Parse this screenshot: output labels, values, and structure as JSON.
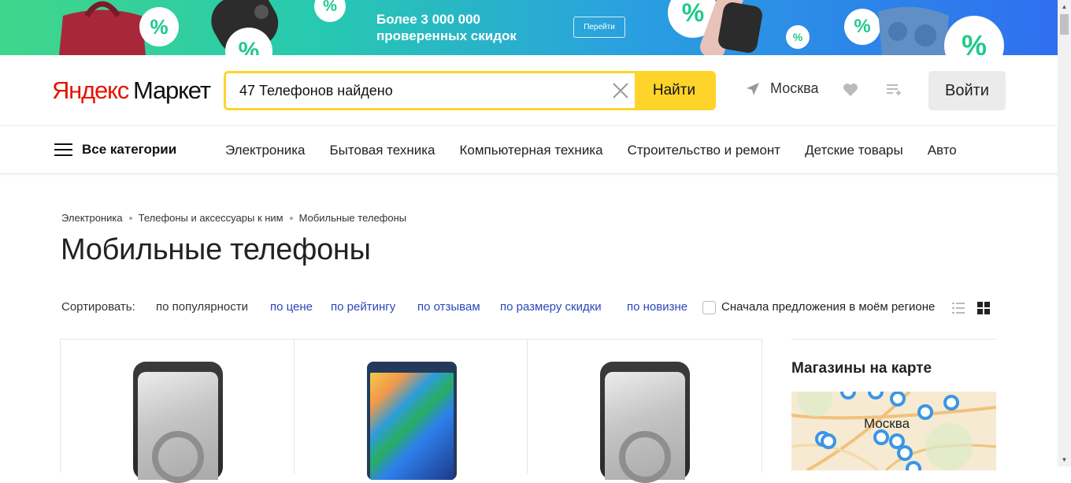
{
  "banner": {
    "text_line1": "Более 3 000 000",
    "text_line2": "проверенных скидок",
    "button_label": "Перейти",
    "percent_symbol": "%"
  },
  "header": {
    "logo_yandex": "Яндекс",
    "logo_market": "Маркет",
    "search_value": "47 Телефонов найдено",
    "find_button": "Найти",
    "city": "Москва",
    "login_button": "Войти"
  },
  "nav": {
    "all_categories": "Все категории",
    "categories": [
      "Электроника",
      "Бытовая техника",
      "Компьютерная техника",
      "Строительство и ремонт",
      "Детские товары",
      "Авто"
    ]
  },
  "breadcrumb": [
    "Электроника",
    "Телефоны и аксессуары к ним",
    "Мобильные телефоны"
  ],
  "page_title": "Мобильные телефоны",
  "sort": {
    "label": "Сортировать:",
    "active": "по популярности",
    "options": [
      "по цене",
      "по рейтингу",
      "по отзывам",
      "по размеру скидки",
      "по новизне"
    ],
    "region_label": "Сначала предложения в моём регионе"
  },
  "map": {
    "title": "Магазины на карте",
    "city_label": "Москва"
  },
  "colors": {
    "accent_yellow": "#fed42b",
    "link_blue": "#2a48b8",
    "logo_red": "#e61400",
    "map_pin": "#3a96e6"
  },
  "icons": {
    "location": "location-arrow-icon",
    "favorites": "heart-icon",
    "compare": "compare-list-icon",
    "clear": "close-icon",
    "view_list": "list-view-icon",
    "view_grid": "grid-view-icon"
  }
}
